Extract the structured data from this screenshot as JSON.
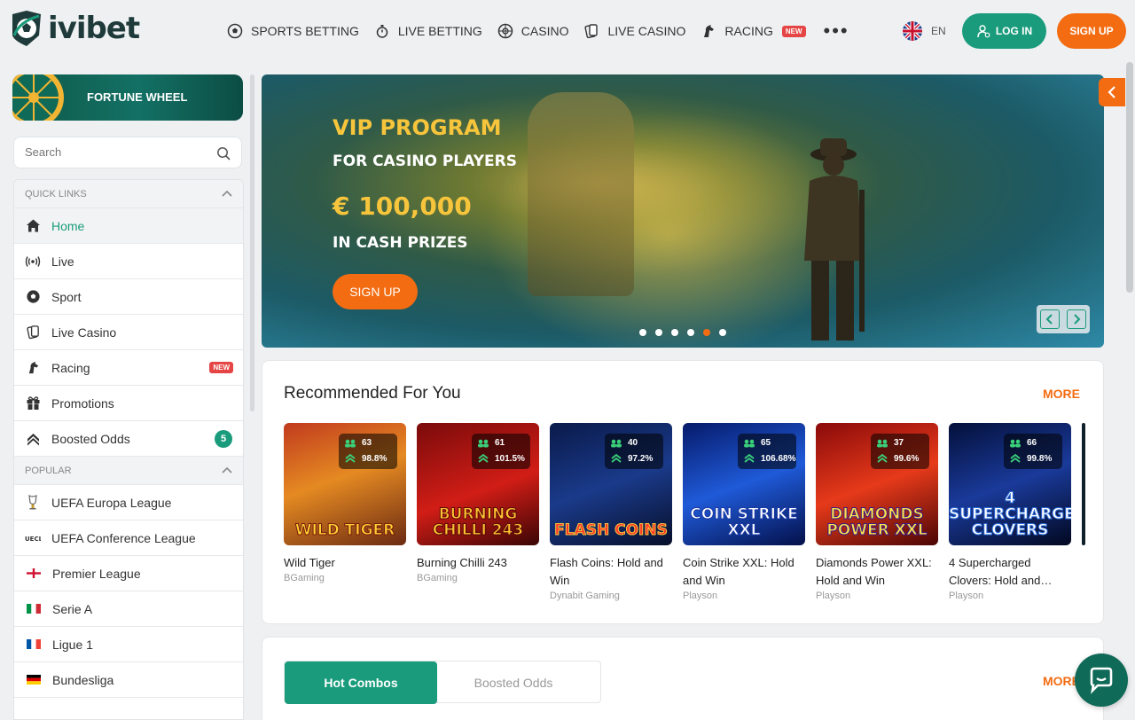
{
  "brand": {
    "name": "ivibet"
  },
  "nav": {
    "items": [
      {
        "label": "SPORTS BETTING",
        "icon": "soccer-ball-icon"
      },
      {
        "label": "LIVE BETTING",
        "icon": "stopwatch-icon"
      },
      {
        "label": "CASINO",
        "icon": "roulette-icon"
      },
      {
        "label": "LIVE CASINO",
        "icon": "cards-icon"
      },
      {
        "label": "RACING",
        "icon": "horse-icon",
        "badge": "NEW"
      }
    ],
    "more_label": "•••"
  },
  "header": {
    "language": "EN",
    "login_label": "LOG IN",
    "signup_label": "SIGN UP"
  },
  "sidebar": {
    "fortune_label": "FORTUNE WHEEL",
    "search_placeholder": "Search",
    "quick_links_title": "QUICK LINKS",
    "quick_links": [
      {
        "label": "Home",
        "icon": "home-icon",
        "active": true
      },
      {
        "label": "Live",
        "icon": "broadcast-icon"
      },
      {
        "label": "Sport",
        "icon": "soccer-ball-icon"
      },
      {
        "label": "Live Casino",
        "icon": "cards-icon"
      },
      {
        "label": "Racing",
        "icon": "horse-icon",
        "badge": "NEW"
      },
      {
        "label": "Promotions",
        "icon": "gift-icon"
      },
      {
        "label": "Boosted Odds",
        "icon": "boost-icon",
        "count": "5"
      }
    ],
    "popular_title": "POPULAR",
    "popular": [
      {
        "label": "UEFA Europa League",
        "icon": "europa-league-icon"
      },
      {
        "label": "UEFA Conference League",
        "icon": "conference-league-icon"
      },
      {
        "label": "Premier League",
        "icon": "england-flag-icon"
      },
      {
        "label": "Serie A",
        "icon": "italy-flag-icon"
      },
      {
        "label": "Ligue 1",
        "icon": "france-flag-icon"
      },
      {
        "label": "Bundesliga",
        "icon": "germany-flag-icon"
      }
    ]
  },
  "banner": {
    "line1": "VIP PROGRAM",
    "line2": "FOR CASINO PLAYERS",
    "line3": "€ 100,000",
    "line4": "IN CASH PRIZES",
    "cta": "SIGN UP",
    "slide_count": 6,
    "active_slide": 4
  },
  "recommended": {
    "title": "Recommended For You",
    "more_label": "MORE",
    "games": [
      {
        "name": "Wild Tiger",
        "provider": "BGaming",
        "players": "63",
        "rtp": "98.8%",
        "art": "WILD TIGER"
      },
      {
        "name": "Burning Chilli 243",
        "provider": "BGaming",
        "players": "61",
        "rtp": "101.5%",
        "art": "BURNING CHILLI 243"
      },
      {
        "name": "Flash Coins: Hold and Win",
        "provider": "Dynabit Gaming",
        "players": "40",
        "rtp": "97.2%",
        "art": "FLASH COINS"
      },
      {
        "name": "Coin Strike XXL: Hold and Win",
        "provider": "Playson",
        "players": "65",
        "rtp": "106.68%",
        "art": "COIN STRIKE XXL"
      },
      {
        "name": "Diamonds Power XXL: Hold and Win",
        "provider": "Playson",
        "players": "37",
        "rtp": "99.6%",
        "art": "DIAMONDS POWER XXL"
      },
      {
        "name": "4 Supercharged Clovers: Hold and…",
        "provider": "Playson",
        "players": "66",
        "rtp": "99.8%",
        "art": "4 SUPERCHARGED CLOVERS"
      }
    ]
  },
  "combos": {
    "tabs": [
      "Hot Combos",
      "Boosted Odds"
    ],
    "active_tab": 0,
    "more_label": "MORE"
  },
  "colors": {
    "brand_green": "#1a9c7c",
    "accent_orange": "#f36c12",
    "vip_gold": "#f7c53c",
    "badge_red": "#e54545"
  }
}
